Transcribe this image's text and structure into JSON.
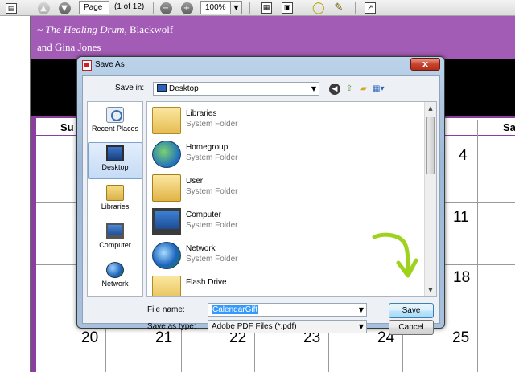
{
  "toolbar": {
    "page_value": "Page 1",
    "page_count": "(1 of 12)",
    "zoom_value": "100%"
  },
  "calendar": {
    "quote_title": "~ The Healing Drum,",
    "quote_author": "Blackwolf",
    "quote_line2": "and Gina Jones",
    "headers": [
      "Su",
      "Sa"
    ],
    "numbers": [
      "4",
      "11",
      "18",
      "20",
      "21",
      "22",
      "23",
      "24",
      "25"
    ]
  },
  "dialog": {
    "title": "Save As",
    "close": "x",
    "save_in_label": "Save in:",
    "save_in_value": "Desktop",
    "places": [
      "Recent Places",
      "Desktop",
      "Libraries",
      "Computer",
      "Network"
    ],
    "files": [
      {
        "name": "Libraries",
        "type": "System Folder"
      },
      {
        "name": "Homegroup",
        "type": "System Folder"
      },
      {
        "name": "User",
        "type": "System Folder"
      },
      {
        "name": "Computer",
        "type": "System Folder"
      },
      {
        "name": "Network",
        "type": "System Folder"
      },
      {
        "name": "Flash Drive",
        "type": ""
      }
    ],
    "file_name_label": "File name:",
    "file_name_value": "CalendarGift",
    "save_type_label": "Save as type:",
    "save_type_value": "Adobe PDF Files (*.pdf)",
    "save_button": "Save",
    "cancel_button": "Cancel"
  },
  "colors": {
    "header_purple": "#a35cb5",
    "annotation_green": "#9fd21c"
  }
}
